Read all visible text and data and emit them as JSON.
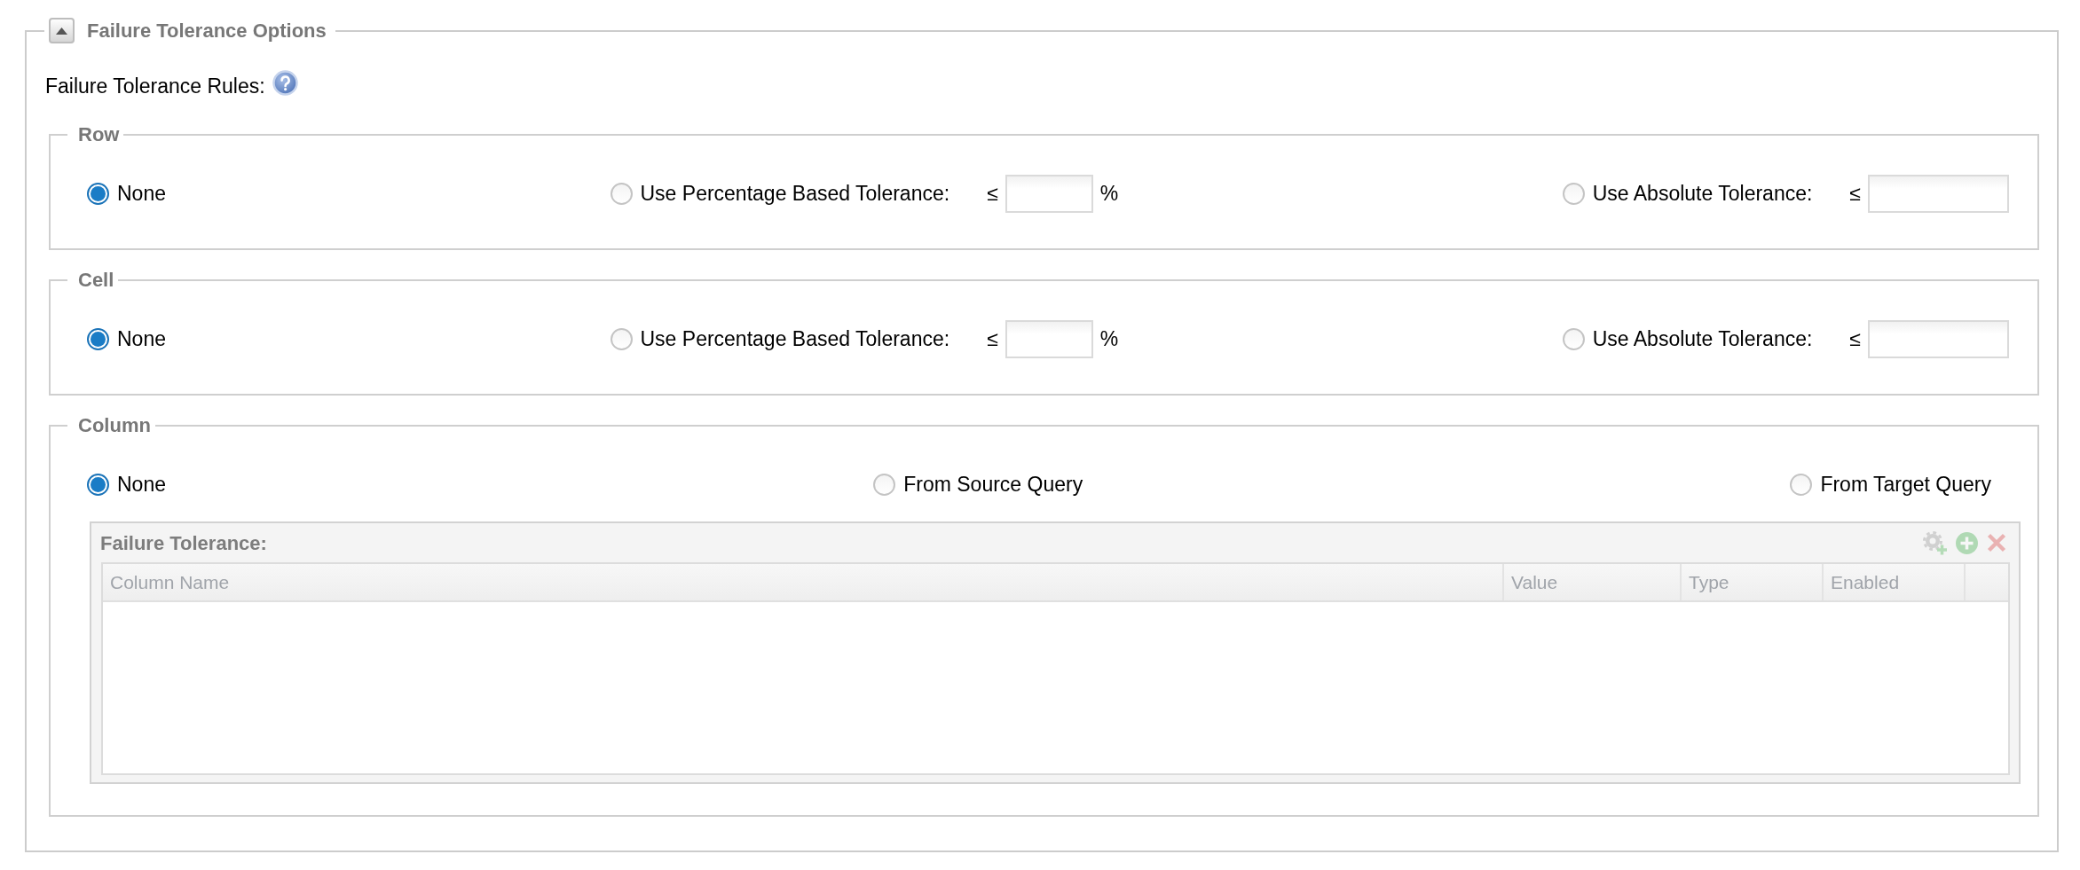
{
  "panel": {
    "title": "Failure Tolerance Options",
    "expanded": true
  },
  "rules": {
    "label": "Failure Tolerance Rules:"
  },
  "groups": [
    {
      "title": "Row",
      "options": [
        {
          "kind": "radio",
          "label": "None",
          "selected": true
        },
        {
          "kind": "percent",
          "label": "Use Percentage Based Tolerance:",
          "operator": "≤",
          "unit": "%",
          "selected": false
        },
        {
          "kind": "absolute",
          "label": "Use Absolute Tolerance:",
          "operator": "≤",
          "selected": false
        }
      ]
    },
    {
      "title": "Cell",
      "options": [
        {
          "kind": "radio",
          "label": "None",
          "selected": true
        },
        {
          "kind": "percent",
          "label": "Use Percentage Based Tolerance:",
          "operator": "≤",
          "unit": "%",
          "selected": false
        },
        {
          "kind": "absolute",
          "label": "Use Absolute Tolerance:",
          "operator": "≤",
          "selected": false
        }
      ]
    },
    {
      "title": "Column",
      "options": [
        {
          "kind": "radio",
          "label": "None",
          "selected": true
        },
        {
          "kind": "radio",
          "label": "From Source Query",
          "selected": false
        },
        {
          "kind": "radio",
          "label": "From Target Query",
          "selected": false
        }
      ],
      "grid": {
        "title": "Failure Tolerance:",
        "toolbar": [
          {
            "kind": "settings-add",
            "disabled": true
          },
          {
            "kind": "add",
            "disabled": true
          },
          {
            "kind": "delete",
            "disabled": true
          }
        ],
        "columns": [
          "Column Name",
          "Value",
          "Type",
          "Enabled"
        ]
      }
    }
  ]
}
